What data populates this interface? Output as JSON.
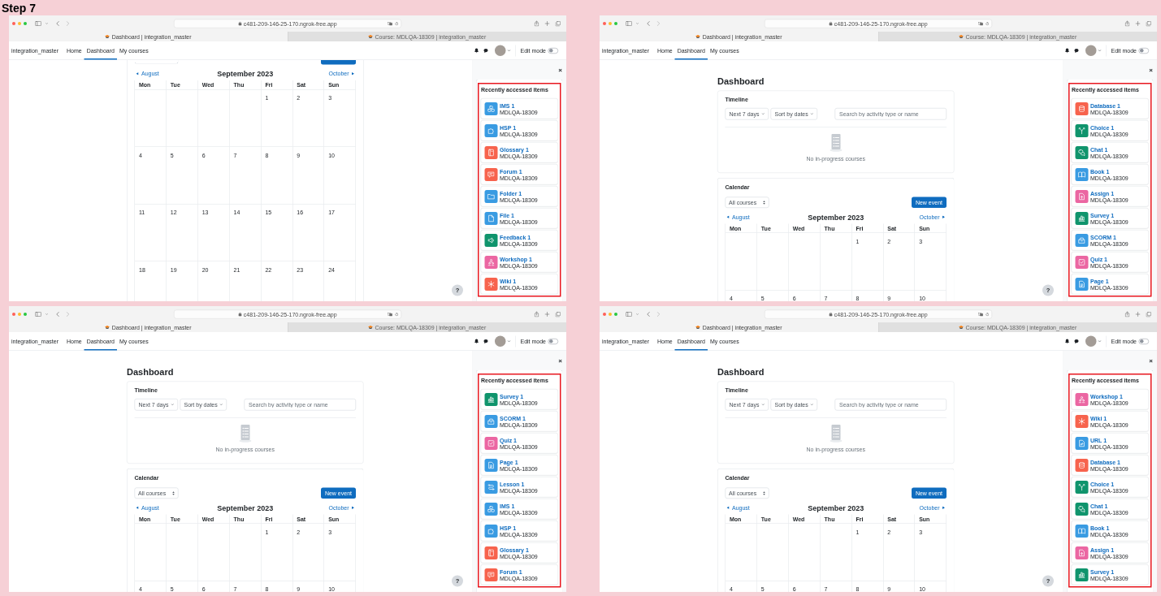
{
  "title": "Step 7",
  "screenshots": [
    {
      "browser": {
        "url": "c481-209-146-25-170.ngrok-free.app",
        "tabs": [
          {
            "title": "Dashboard | integration_master",
            "selected": true
          },
          {
            "title": "Course: MDLQA-18309 | integration_master",
            "selected": false
          }
        ]
      },
      "navbar": {
        "site_name": "integration_master",
        "links": [
          {
            "label": "Home",
            "selected": false
          },
          {
            "label": "Dashboard",
            "selected": true
          },
          {
            "label": "My courses",
            "selected": false
          }
        ],
        "edit_mode": {
          "label": "Edit mode",
          "on": false
        }
      },
      "main": {
        "calendar": {
          "prev": "August",
          "month": "September 2023",
          "next": "October",
          "weekdays": [
            "Mon",
            "Tue",
            "Wed",
            "Thu",
            "Fri",
            "Sat",
            "Sun"
          ],
          "weeks": [
            [
              "1",
              "2",
              "3"
            ],
            [
              "4",
              "5",
              "6",
              "7",
              "8",
              "9",
              "10"
            ],
            [
              "11",
              "12",
              "13",
              "14",
              "15",
              "16",
              "17"
            ],
            [
              "18",
              "19",
              "20",
              "21",
              "22",
              "23",
              "24"
            ]
          ]
        },
        "help": "?"
      },
      "drawer": {
        "close": "×",
        "block": {
          "title": "Recently accessed items",
          "items": [
            {
              "name": "IMS 1",
              "course": "MDLQA-18309",
              "kind": "ims",
              "color": "#399be2"
            },
            {
              "name": "HSP 1",
              "course": "MDLQA-18309",
              "kind": "h5p",
              "color": "#399be2"
            },
            {
              "name": "Glossary 1",
              "course": "MDLQA-18309",
              "kind": "glossary",
              "color": "#f7634d"
            },
            {
              "name": "Forum 1",
              "course": "MDLQA-18309",
              "kind": "forum",
              "color": "#f7634d"
            },
            {
              "name": "Folder 1",
              "course": "MDLQA-18309",
              "kind": "folder",
              "color": "#399be2"
            },
            {
              "name": "File 1",
              "course": "MDLQA-18309",
              "kind": "file",
              "color": "#399be2"
            },
            {
              "name": "Feedback 1",
              "course": "MDLQA-18309",
              "kind": "feedback",
              "color": "#0f946c"
            },
            {
              "name": "Workshop 1",
              "course": "MDLQA-18309",
              "kind": "workshop",
              "color": "#eb66a2"
            },
            {
              "name": "Wiki 1",
              "course": "MDLQA-18309",
              "kind": "wiki",
              "color": "#f7634d"
            }
          ]
        }
      }
    },
    {
      "browser": {
        "url": "c481-209-146-25-170.ngrok-free.app",
        "tabs": [
          {
            "title": "Dashboard | integration_master",
            "selected": true
          },
          {
            "title": "Course: MDLQA-18309 | integration_master",
            "selected": false
          }
        ]
      },
      "navbar": {
        "site_name": "integration_master",
        "links": [
          {
            "label": "Home",
            "selected": false
          },
          {
            "label": "Dashboard",
            "selected": true
          },
          {
            "label": "My courses",
            "selected": false
          }
        ],
        "edit_mode": {
          "label": "Edit mode",
          "on": false
        }
      },
      "main": {
        "heading": "Dashboard",
        "timeline": {
          "title": "Timeline",
          "filters": [
            "Next 7 days",
            "Sort by dates"
          ],
          "search": {
            "placeholder": "Search by activity type or name"
          },
          "empty_text": "No in-progress courses"
        },
        "calendar": {
          "title": "Calendar",
          "course_filter": "All courses",
          "new_event": "New event",
          "prev": "August",
          "month": "September 2023",
          "next": "October",
          "weekdays": [
            "Mon",
            "Tue",
            "Wed",
            "Thu",
            "Fri",
            "Sat",
            "Sun"
          ],
          "weeks": [
            [
              "1",
              "2",
              "3"
            ],
            [
              "4",
              "5",
              "6",
              "7",
              "8",
              "9",
              "10"
            ]
          ]
        },
        "help": "?"
      },
      "drawer": {
        "close": "×",
        "block": {
          "title": "Recently accessed items",
          "items": [
            {
              "name": "Database 1",
              "course": "MDLQA-18309",
              "kind": "database",
              "color": "#f7634d"
            },
            {
              "name": "Choice 1",
              "course": "MDLQA-18309",
              "kind": "choice",
              "color": "#0f946c"
            },
            {
              "name": "Chat 1",
              "course": "MDLQA-18309",
              "kind": "chat",
              "color": "#0f946c"
            },
            {
              "name": "Book 1",
              "course": "MDLQA-18309",
              "kind": "book",
              "color": "#399be2"
            },
            {
              "name": "Assign 1",
              "course": "MDLQA-18309",
              "kind": "assign",
              "color": "#eb66a2"
            },
            {
              "name": "Survey 1",
              "course": "MDLQA-18309",
              "kind": "survey",
              "color": "#0f946c"
            },
            {
              "name": "SCORM 1",
              "course": "MDLQA-18309",
              "kind": "scorm",
              "color": "#399be2"
            },
            {
              "name": "Quiz 1",
              "course": "MDLQA-18309",
              "kind": "quiz",
              "color": "#eb66a2"
            },
            {
              "name": "Page 1",
              "course": "MDLQA-18309",
              "kind": "page",
              "color": "#399be2"
            }
          ]
        }
      }
    },
    {
      "browser": {
        "url": "c481-209-146-25-170.ngrok-free.app",
        "tabs": [
          {
            "title": "Dashboard | integration_master",
            "selected": true
          },
          {
            "title": "Course: MDLQA-18309 | integration_master",
            "selected": false
          }
        ]
      },
      "navbar": {
        "site_name": "integration_master",
        "links": [
          {
            "label": "Home",
            "selected": false
          },
          {
            "label": "Dashboard",
            "selected": true
          },
          {
            "label": "My courses",
            "selected": false
          }
        ],
        "edit_mode": {
          "label": "Edit mode",
          "on": false
        }
      },
      "main": {
        "heading": "Dashboard",
        "timeline": {
          "title": "Timeline",
          "filters": [
            "Next 7 days",
            "Sort by dates"
          ],
          "search": {
            "placeholder": "Search by activity type or name"
          },
          "empty_text": "No in-progress courses"
        },
        "calendar": {
          "title": "Calendar",
          "course_filter": "All courses",
          "new_event": "New event",
          "prev": "August",
          "month": "September 2023",
          "next": "October",
          "weekdays": [
            "Mon",
            "Tue",
            "Wed",
            "Thu",
            "Fri",
            "Sat",
            "Sun"
          ],
          "weeks": [
            [
              "1",
              "2",
              "3"
            ],
            [
              "4",
              "5",
              "6",
              "7",
              "8",
              "9",
              "10"
            ]
          ]
        },
        "help": "?"
      },
      "drawer": {
        "close": "×",
        "block": {
          "title": "Recently accessed items",
          "items": [
            {
              "name": "Survey 1",
              "course": "MDLQA-18309",
              "kind": "survey",
              "color": "#0f946c"
            },
            {
              "name": "SCORM 1",
              "course": "MDLQA-18309",
              "kind": "scorm",
              "color": "#399be2"
            },
            {
              "name": "Quiz 1",
              "course": "MDLQA-18309",
              "kind": "quiz",
              "color": "#eb66a2"
            },
            {
              "name": "Page 1",
              "course": "MDLQA-18309",
              "kind": "page",
              "color": "#399be2"
            },
            {
              "name": "Lesson 1",
              "course": "MDLQA-18309",
              "kind": "lesson",
              "color": "#399be2"
            },
            {
              "name": "IMS 1",
              "course": "MDLQA-18309",
              "kind": "ims",
              "color": "#399be2"
            },
            {
              "name": "HSP 1",
              "course": "MDLQA-18309",
              "kind": "h5p",
              "color": "#399be2"
            },
            {
              "name": "Glossary 1",
              "course": "MDLQA-18309",
              "kind": "glossary",
              "color": "#f7634d"
            },
            {
              "name": "Forum 1",
              "course": "MDLQA-18309",
              "kind": "forum",
              "color": "#f7634d"
            }
          ]
        }
      }
    },
    {
      "browser": {
        "url": "c481-209-146-25-170.ngrok-free.app",
        "tabs": [
          {
            "title": "Dashboard | integration_master",
            "selected": true
          },
          {
            "title": "Course: MDLQA-18309 | integration_master",
            "selected": false
          }
        ]
      },
      "navbar": {
        "site_name": "integration_master",
        "links": [
          {
            "label": "Home",
            "selected": false
          },
          {
            "label": "Dashboard",
            "selected": true
          },
          {
            "label": "My courses",
            "selected": false
          }
        ],
        "edit_mode": {
          "label": "Edit mode",
          "on": false
        }
      },
      "main": {
        "heading": "Dashboard",
        "timeline": {
          "title": "Timeline",
          "filters": [
            "Next 7 days",
            "Sort by dates"
          ],
          "search": {
            "placeholder": "Search by activity type or name"
          },
          "empty_text": "No in-progress courses"
        },
        "calendar": {
          "title": "Calendar",
          "course_filter": "All courses",
          "new_event": "New event",
          "prev": "August",
          "month": "September 2023",
          "next": "October",
          "weekdays": [
            "Mon",
            "Tue",
            "Wed",
            "Thu",
            "Fri",
            "Sat",
            "Sun"
          ],
          "weeks": [
            [
              "1",
              "2",
              "3"
            ],
            [
              "4",
              "5",
              "6",
              "7",
              "8",
              "9",
              "10"
            ]
          ]
        },
        "help": "?"
      },
      "drawer": {
        "close": "×",
        "block": {
          "title": "Recently accessed items",
          "items": [
            {
              "name": "Workshop 1",
              "course": "MDLQA-18309",
              "kind": "workshop",
              "color": "#eb66a2"
            },
            {
              "name": "Wiki 1",
              "course": "MDLQA-18309",
              "kind": "wiki",
              "color": "#f7634d"
            },
            {
              "name": "URL 1",
              "course": "MDLQA-18309",
              "kind": "url",
              "color": "#399be2"
            },
            {
              "name": "Database 1",
              "course": "MDLQA-18309",
              "kind": "database",
              "color": "#f7634d"
            },
            {
              "name": "Choice 1",
              "course": "MDLQA-18309",
              "kind": "choice",
              "color": "#0f946c"
            },
            {
              "name": "Chat 1",
              "course": "MDLQA-18309",
              "kind": "chat",
              "color": "#0f946c"
            },
            {
              "name": "Book 1",
              "course": "MDLQA-18309",
              "kind": "book",
              "color": "#399be2"
            },
            {
              "name": "Assign 1",
              "course": "MDLQA-18309",
              "kind": "assign",
              "color": "#eb66a2"
            },
            {
              "name": "Survey 1",
              "course": "MDLQA-18309",
              "kind": "survey",
              "color": "#0f946c"
            }
          ]
        }
      }
    }
  ]
}
